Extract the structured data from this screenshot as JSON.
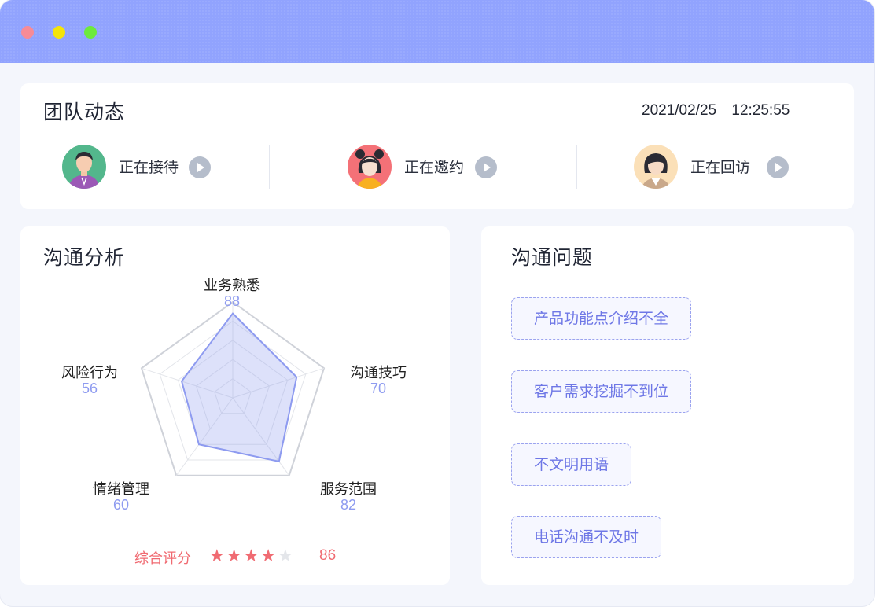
{
  "window": {
    "dots": [
      {
        "name": "close",
        "color": "#f78b97"
      },
      {
        "name": "minimize",
        "color": "#f4e40a"
      },
      {
        "name": "maximize",
        "color": "#6dea3c"
      }
    ]
  },
  "team": {
    "title": "团队动态",
    "date": "2021/02/25",
    "time": "12:25:55",
    "members": [
      {
        "status": "正在接待",
        "avatar": "male-avatar-icon"
      },
      {
        "status": "正在邀约",
        "avatar": "female-bun-avatar-icon"
      },
      {
        "status": "正在回访",
        "avatar": "female-bob-avatar-icon"
      }
    ]
  },
  "analysis": {
    "title": "沟通分析",
    "rating_label": "综合评分",
    "rating_stars": 4,
    "rating_max": 5,
    "rating_value": "86"
  },
  "chart_data": {
    "type": "radar",
    "max": 100,
    "axes": [
      {
        "label": "业务熟悉",
        "value": 88
      },
      {
        "label": "沟通技巧",
        "value": 70
      },
      {
        "label": "服务范围",
        "value": 82
      },
      {
        "label": "情绪管理",
        "value": 60
      },
      {
        "label": "风险行为",
        "value": 56
      }
    ],
    "series_color": "#8e9bf0"
  },
  "problems": {
    "title": "沟通问题",
    "tags": [
      "产品功能点介绍不全",
      "客户需求挖掘不到位",
      "不文明用语",
      "电话沟通不及时"
    ]
  }
}
